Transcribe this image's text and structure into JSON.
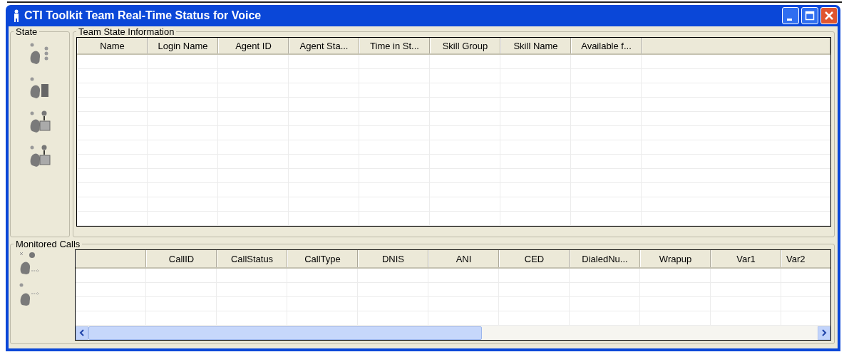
{
  "window": {
    "title": "CTI Toolkit Team Real-Time Status for Voice"
  },
  "state_group": {
    "label": "State"
  },
  "team_state": {
    "label": "Team State Information",
    "columns": [
      "Name",
      "Login Name",
      "Agent ID",
      "Agent Sta...",
      "Time in St...",
      "Skill Group",
      "Skill Name",
      "Available f..."
    ]
  },
  "monitored_calls": {
    "label": "Monitored Calls",
    "columns": [
      "",
      "CallID",
      "CallStatus",
      "CallType",
      "DNIS",
      "ANI",
      "CED",
      "DialedNu...",
      "Wrapup",
      "Var1",
      "Var2"
    ]
  }
}
